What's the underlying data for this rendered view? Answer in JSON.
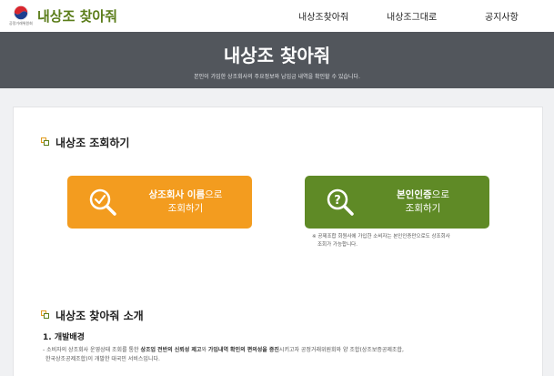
{
  "header": {
    "logo_sub": "공정거래위원회",
    "brand": "내상조 찾아줘",
    "nav": [
      "내상조찾아줘",
      "내상조그대로",
      "공지사항"
    ]
  },
  "hero": {
    "title": "내상조 찾아줘",
    "subtitle": "본인이 가입한 상조회사의 주요정보와 납입금 내역을 확인할 수 있습니다."
  },
  "lookup": {
    "title": "내상조 조회하기",
    "company_btn": {
      "bold": "상조회사 이름",
      "rest": "으로",
      "line2": "조회하기",
      "icon": "search-check-icon"
    },
    "auth_btn": {
      "bold": "본인인증",
      "rest": "으로",
      "line2": "조회하기",
      "icon": "search-question-icon"
    },
    "note_line1": "※ 공제조합 회원사에 가입한 소비자는 본인인증만으로도 상조회사",
    "note_line2": "조회가 가능합니다."
  },
  "intro": {
    "title": "내상조 찾아줘 소개",
    "heading": "1. 개발배경",
    "p_a": "- 소비자의 상조회사 운영상태 조회를 통한 ",
    "p_b": "상조업 전반의 신뢰성 제고",
    "p_c": "와 ",
    "p_d": "가입내역 확인의 편의성을 증진",
    "p_e": "시키고자 공정거래위원회와 양 조합(상조보증공제조합,",
    "p_f": "한국상조공제조합)이 개발한 대국민 서비스입니다."
  },
  "colors": {
    "accent_orange": "#f39c1f",
    "accent_green": "#5f8a26",
    "brand": "#5b7d1a",
    "hero_bg": "#52565c"
  }
}
